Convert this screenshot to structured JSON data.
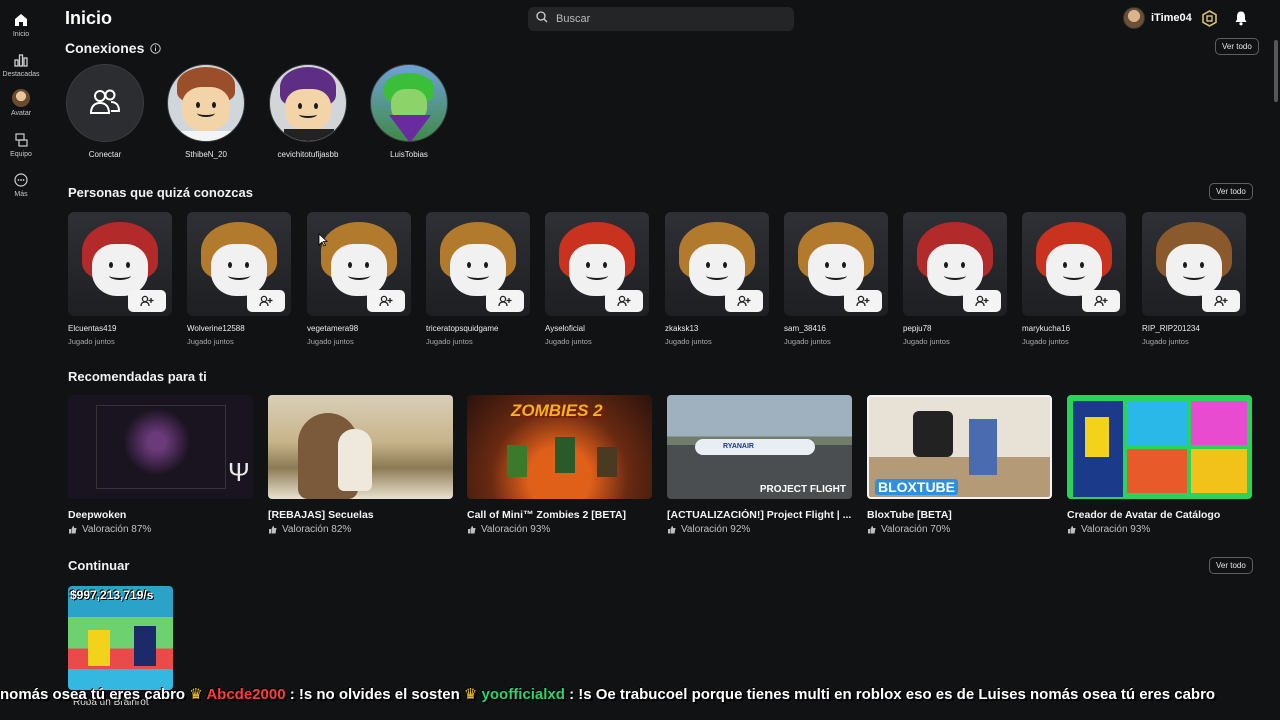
{
  "nav": {
    "items": [
      {
        "label": "Inicio",
        "icon": "home-icon"
      },
      {
        "label": "Destacadas",
        "icon": "chart-icon"
      },
      {
        "label": "Avatar",
        "icon": "avatar-icon"
      },
      {
        "label": "Equipo",
        "icon": "team-icon"
      },
      {
        "label": "Más",
        "icon": "more-icon"
      }
    ]
  },
  "header": {
    "title": "Inicio",
    "search_placeholder": "Buscar",
    "username": "iTime04"
  },
  "connections": {
    "title": "Conexiones",
    "see_all": "Ver todo",
    "items": [
      {
        "name": "Conectar"
      },
      {
        "name": "SthibeN_20"
      },
      {
        "name": "cevichitotufijasbb"
      },
      {
        "name": "LuisTobias"
      }
    ]
  },
  "people": {
    "title": "Personas que quizá conozcas",
    "see_all": "Ver todo",
    "items": [
      {
        "name": "Elcuentas419",
        "sub": "Jugado juntos",
        "hair": "#b22a2a"
      },
      {
        "name": "Wolverine12588",
        "sub": "Jugado juntos",
        "hair": "#b27a2c"
      },
      {
        "name": "vegetamera98",
        "sub": "Jugado juntos",
        "hair": "#b27a2c"
      },
      {
        "name": "triceratopsquidgame",
        "sub": "Jugado juntos",
        "hair": "#b27a2c"
      },
      {
        "name": "Ayseloficial",
        "sub": "Jugado juntos",
        "hair": "#c8321e"
      },
      {
        "name": "zkaksk13",
        "sub": "Jugado juntos",
        "hair": "#b27a2c"
      },
      {
        "name": "sam_38416",
        "sub": "Jugado juntos",
        "hair": "#b27a2c"
      },
      {
        "name": "pepju78",
        "sub": "Jugado juntos",
        "hair": "#b22a2a"
      },
      {
        "name": "marykucha16",
        "sub": "Jugado juntos",
        "hair": "#c8321e"
      },
      {
        "name": "RIP_RIP201234",
        "sub": "Jugado juntos",
        "hair": "#8a5a2c"
      }
    ]
  },
  "recommended": {
    "title": "Recomendadas para ti",
    "items": [
      {
        "title": "Deepwoken",
        "rating": "Valoración 87%"
      },
      {
        "title": "[REBAJAS] Secuelas",
        "rating": "Valoración 82%"
      },
      {
        "title": "Call of Mini™ Zombies 2 [BETA]",
        "rating": "Valoración 93%",
        "art_text": "ZOMBIES 2"
      },
      {
        "title": "[ACTUALIZACIÓN!] Project Flight | ...",
        "rating": "Valoración 92%",
        "art_text": "PROJECT FLIGHT",
        "art_text2": "RYANAIR"
      },
      {
        "title": "BloxTube [BETA]",
        "rating": "Valoración 70%",
        "art_text": "BLOXTUBE"
      },
      {
        "title": "Creador de Avatar de Catálogo",
        "rating": "Valoración 93%"
      }
    ]
  },
  "continue": {
    "title": "Continuar",
    "see_all": "Ver todo",
    "card_price": "$997,213,719/s",
    "card_title": "Roba un Brainrot"
  },
  "chat": {
    "segment1": "nomás osea tú eres cabro ",
    "user1": "Abcde2000",
    "msg1": " : !s no olvides el sosten ",
    "user2": "yoofficialxd",
    "msg2": " : !s Oe trabucoel porque tienes multi en roblox eso es de Luises nomás osea tú eres cabro"
  },
  "colors": {
    "background": "#111214",
    "search_bg": "#232527",
    "user1": "#ff3b3b",
    "user2": "#2bd46b"
  }
}
